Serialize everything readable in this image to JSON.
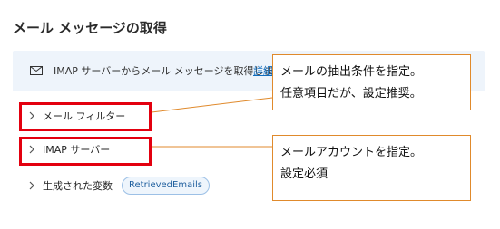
{
  "page": {
    "title": "メール メッセージの取得"
  },
  "info_banner": {
    "icon": "mail-icon",
    "text": "IMAP サーバーからメール メッセージを取得します",
    "link_label": "詳細"
  },
  "sections": {
    "mail_filter": {
      "label": "メール フィルター",
      "icon": "chevron-right-icon"
    },
    "imap_server": {
      "label": "IMAP サーバー",
      "icon": "chevron-right-icon"
    },
    "generated_vars": {
      "label": "生成された変数",
      "icon": "chevron-right-icon",
      "chip": "RetrievedEmails"
    }
  },
  "callouts": {
    "mail_filter": {
      "line1": "メールの抽出条件を指定。",
      "line2": "任意項目だが、設定推奨。"
    },
    "imap_server": {
      "line1": "メールアカウントを指定。",
      "line2": "設定必須"
    }
  },
  "colors": {
    "highlight": "#e3000f",
    "callout_border": "#e08a2c",
    "banner_bg": "#eef4fb",
    "link": "#0f6cbd",
    "chip_border": "#9cc0e6"
  }
}
